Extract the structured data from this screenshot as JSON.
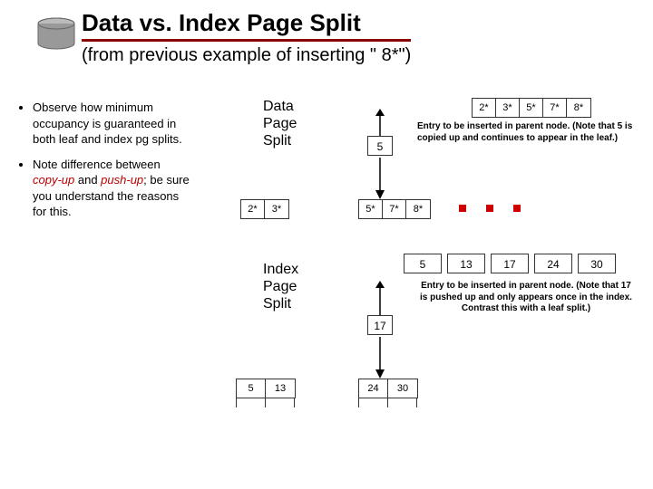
{
  "header": {
    "title": "Data vs. Index Page Split",
    "subtitle": "(from previous example of inserting \" 8*\")"
  },
  "bullets": {
    "items": [
      {
        "text": "Observe how minimum occupancy is guaranteed in both leaf and index pg splits."
      },
      {
        "text_pre": "Note difference between ",
        "copyup": "copy-up",
        "mid": " and ",
        "pushup": "push-up",
        "text_post": "; be sure you understand the reasons for this."
      }
    ]
  },
  "labels": {
    "data_split_l1": "Data",
    "data_split_l2": "Page",
    "data_split_l3": "Split",
    "index_split_l1": "Index",
    "index_split_l2": "Page",
    "index_split_l3": "Split"
  },
  "data_split": {
    "top_cells": [
      "2*",
      "3*",
      "5*",
      "7*",
      "8*"
    ],
    "note": "Entry to be inserted in parent node. (Note that 5 is copied up and continues to appear in the leaf.)",
    "pushed": "5",
    "left_leaf": [
      "2*",
      "3*"
    ],
    "right_leaf": [
      "5*",
      "7*",
      "8*"
    ]
  },
  "index_split": {
    "top_cells": [
      "5",
      "13",
      "17",
      "24",
      "30"
    ],
    "note": "Entry to be inserted in parent node. (Note that 17 is pushed up and only appears once in the index. Contrast this with a leaf split.)",
    "pushed": "17",
    "left_node": [
      "5",
      "13"
    ],
    "right_node": [
      "24",
      "30"
    ]
  }
}
